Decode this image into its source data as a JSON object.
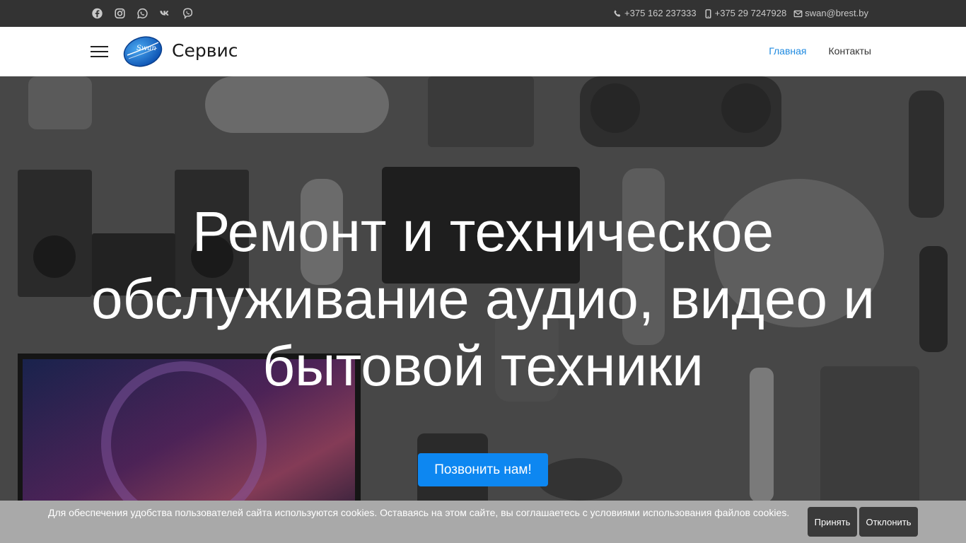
{
  "topbar": {
    "social_icons": [
      "facebook-icon",
      "instagram-icon",
      "whatsapp-icon",
      "vk-icon",
      "viber-icon"
    ],
    "phone1": "+375 162 237333",
    "phone2": "+375 29 7247928",
    "email": "swan@brest.by"
  },
  "header": {
    "logo_text": "Swan",
    "brand": "Сервис",
    "nav": [
      {
        "label": "Главная",
        "active": true
      },
      {
        "label": "Контакты",
        "active": false
      }
    ]
  },
  "hero": {
    "title": "Ремонт и техническое обслуживание аудио, видео и бытовой техники",
    "cta": "Позвонить нам!"
  },
  "cookie": {
    "text": "Для обеспечения удобства пользователей сайта используются cookies. Оставаясь на этом сайте, вы соглашаетесь с условиями использования файлов cookies.",
    "accept": "Принять",
    "decline": "Отклонить"
  },
  "colors": {
    "topbar_bg": "#333333",
    "accent": "#1f8ae0",
    "cta_bg": "#0d87f1",
    "cookie_bg": "#a9a9a9",
    "cookie_btn": "#3a3a3a"
  }
}
